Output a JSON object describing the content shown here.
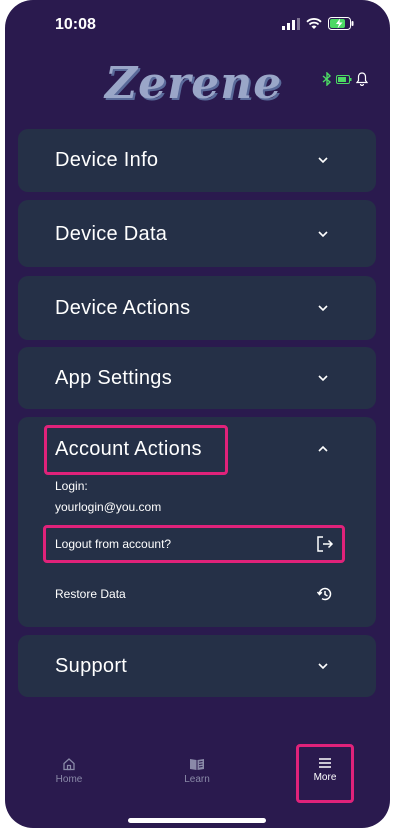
{
  "status": {
    "time": "10:08"
  },
  "header": {
    "logo": "Zerene"
  },
  "sections": {
    "device_info": "Device Info",
    "device_data": "Device Data",
    "device_actions": "Device Actions",
    "app_settings": "App Settings",
    "account_actions": "Account Actions",
    "support": "Support"
  },
  "account": {
    "login_label": "Login:",
    "login_value": "yourlogin@you.com",
    "logout_label": "Logout from account?",
    "restore_label": "Restore Data"
  },
  "nav": {
    "home": "Home",
    "learn": "Learn",
    "more": "More"
  },
  "colors": {
    "background": "#2a1a4e",
    "card": "#253047",
    "highlight": "#e0227a",
    "nav_inactive": "#8a8aa8"
  }
}
